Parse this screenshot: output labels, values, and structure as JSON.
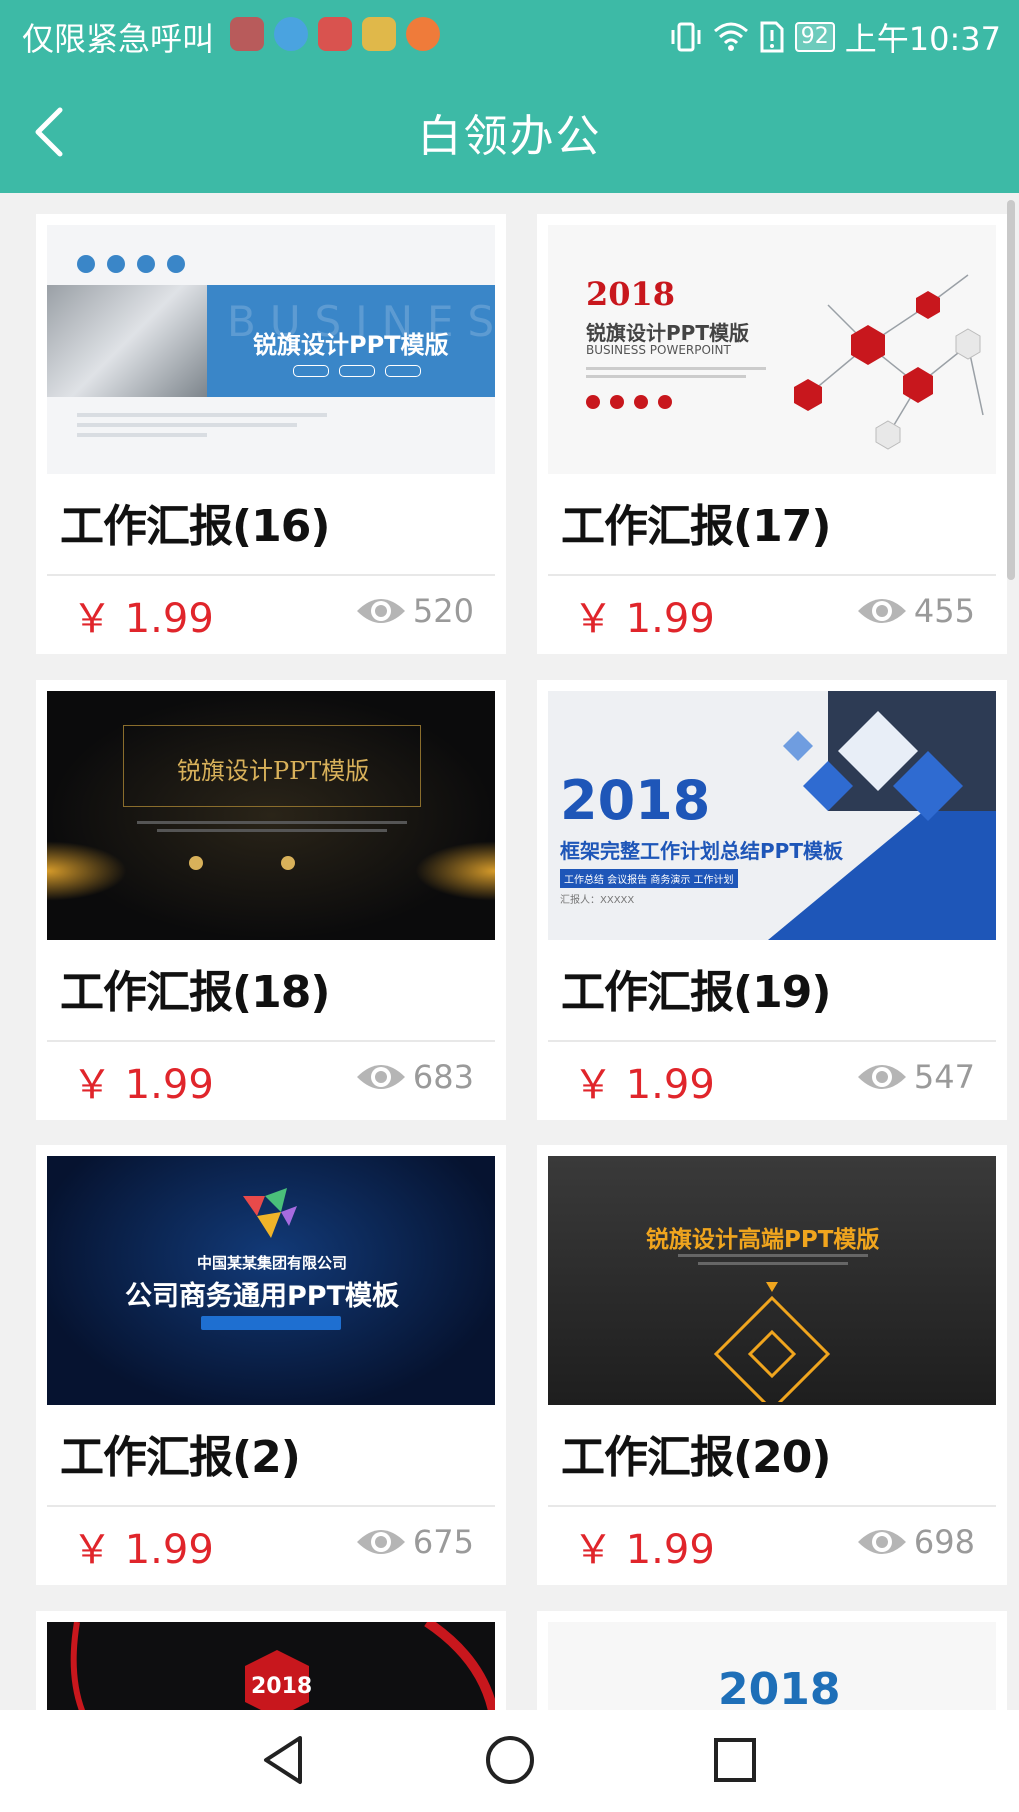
{
  "status": {
    "carrier": "仅限紧急呼叫",
    "battery": "92",
    "time": "上午10:37"
  },
  "header": {
    "title": "白领办公"
  },
  "cards": [
    {
      "title": "工作汇报(16)",
      "price": "￥ 1.99",
      "views": "520"
    },
    {
      "title": "工作汇报(17)",
      "price": "￥ 1.99",
      "views": "455"
    },
    {
      "title": "工作汇报(18)",
      "price": "￥ 1.99",
      "views": "683"
    },
    {
      "title": "工作汇报(19)",
      "price": "￥ 1.99",
      "views": "547"
    },
    {
      "title": "工作汇报(2)",
      "price": "￥ 1.99",
      "views": "675"
    },
    {
      "title": "工作汇报(20)",
      "price": "￥ 1.99",
      "views": "698"
    }
  ],
  "thumbs": {
    "t16": {
      "banner": "锐旗设计PPT模版",
      "watermark": "BUSINESS"
    },
    "t17": {
      "year": "2018",
      "title": "锐旗设计PPT模版",
      "subtitle": "BUSINESS POWERPOINT"
    },
    "t18": {
      "title": "锐旗设计PPT模版"
    },
    "t19": {
      "year": "2018",
      "title": "框架完整工作计划总结PPT模板",
      "tags": "工作总结   会议报告   商务演示   工作计划",
      "reporter": "汇报人：XXXXX"
    },
    "t2": {
      "company": "中国某某集团有限公司",
      "title": "公司商务通用PPT模板"
    },
    "t20": {
      "title": "锐旗设计高端PPT模版"
    },
    "t21": {
      "year": "2018"
    },
    "t22": {
      "year": "2018"
    }
  },
  "colors": {
    "header": "#3dbaa6",
    "price": "#e0252b"
  }
}
